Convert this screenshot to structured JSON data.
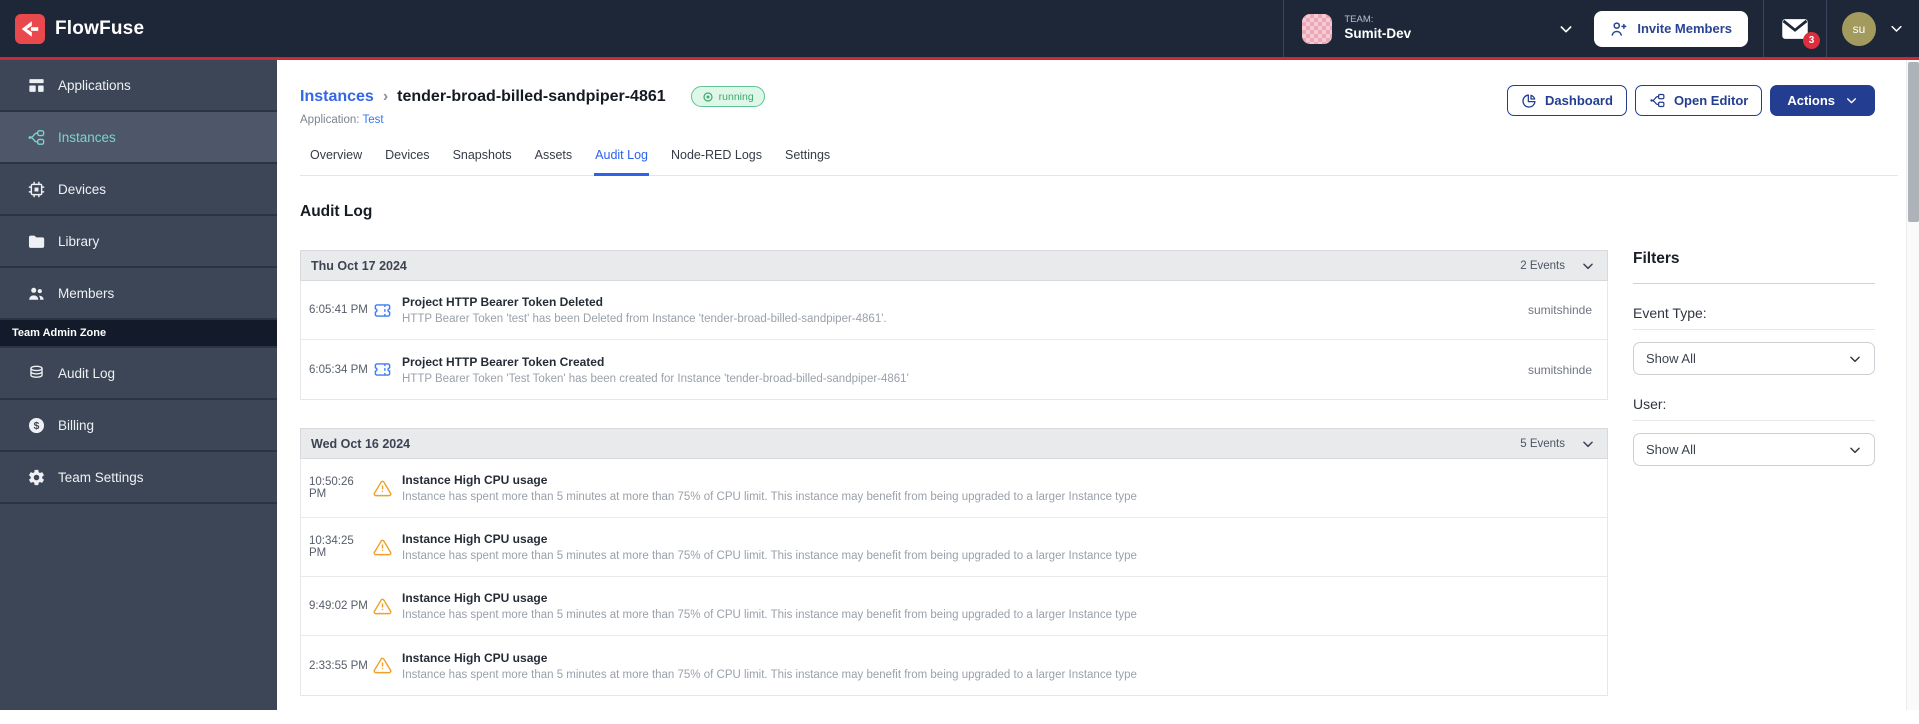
{
  "colors": {
    "topbar_bg": "#1d2738",
    "sidebar_bg": "#3d4656",
    "sidebar_active_bg": "#4e5769",
    "accent_teal": "#7cd6c8",
    "brand_red": "#e9494d",
    "red_line": "#c92a35",
    "navy_button": "#233d91",
    "link_blue": "#3566e8",
    "tab_active_blue": "#2c63e9",
    "running_green_text": "#41a86f",
    "running_green_bg": "#def7e9",
    "warning_orange": "#f0a02a",
    "token_blue": "#3d7ef2",
    "notification_red": "#dc2f3e"
  },
  "topbar": {
    "brand": "FlowFuse",
    "team_label": "TEAM:",
    "team_name": "Sumit-Dev",
    "invite_label": "Invite Members",
    "notification_count": "3",
    "avatar_initials": "su",
    "icons": [
      "flowfuse-logo",
      "team-avatar",
      "chevron-down-icon",
      "invite-members-icon",
      "mail-icon",
      "user-avatar"
    ]
  },
  "sidebar": {
    "items": [
      {
        "label": "Applications",
        "icon": "applications-icon",
        "active": false
      },
      {
        "label": "Instances",
        "icon": "instances-icon",
        "active": true
      },
      {
        "label": "Devices",
        "icon": "devices-icon",
        "active": false
      },
      {
        "label": "Library",
        "icon": "library-icon",
        "active": false
      },
      {
        "label": "Members",
        "icon": "members-icon",
        "active": false
      }
    ],
    "section_label": "Team Admin Zone",
    "admin_items": [
      {
        "label": "Audit Log",
        "icon": "audit-log-icon",
        "active": false
      },
      {
        "label": "Billing",
        "icon": "billing-icon",
        "active": false
      },
      {
        "label": "Team Settings",
        "icon": "team-settings-icon",
        "active": false
      }
    ]
  },
  "header": {
    "breadcrumb_parent": "Instances",
    "breadcrumb_separator": "›",
    "instance_name": "tender-broad-billed-sandpiper-4861",
    "status": "running",
    "application_label": "Application:",
    "application_name": "Test",
    "dashboard_label": "Dashboard",
    "open_editor_label": "Open Editor",
    "actions_label": "Actions"
  },
  "tabs": [
    {
      "label": "Overview",
      "active": false
    },
    {
      "label": "Devices",
      "active": false
    },
    {
      "label": "Snapshots",
      "active": false
    },
    {
      "label": "Assets",
      "active": false
    },
    {
      "label": "Audit Log",
      "active": true
    },
    {
      "label": "Node-RED Logs",
      "active": false
    },
    {
      "label": "Settings",
      "active": false
    }
  ],
  "audit": {
    "title": "Audit Log",
    "groups": [
      {
        "date": "Thu Oct 17 2024",
        "events_count": "2 Events",
        "rows": [
          {
            "time": "6:05:41 PM",
            "icon": "ticket-icon",
            "title": "Project HTTP Bearer Token Deleted",
            "description": "HTTP Bearer Token 'test' has been Deleted from Instance 'tender-broad-billed-sandpiper-4861'.",
            "user": "sumitshinde"
          },
          {
            "time": "6:05:34 PM",
            "icon": "ticket-icon",
            "title": "Project HTTP Bearer Token Created",
            "description": "HTTP Bearer Token 'Test Token' has been created for Instance 'tender-broad-billed-sandpiper-4861'",
            "user": "sumitshinde"
          }
        ]
      },
      {
        "date": "Wed Oct 16 2024",
        "events_count": "5 Events",
        "rows": [
          {
            "time": "10:50:26 PM",
            "icon": "warning-icon",
            "title": "Instance High CPU usage",
            "description": "Instance has spent more than 5 minutes at more than 75% of CPU limit. This instance may benefit from being upgraded to a larger Instance type",
            "user": ""
          },
          {
            "time": "10:34:25 PM",
            "icon": "warning-icon",
            "title": "Instance High CPU usage",
            "description": "Instance has spent more than 5 minutes at more than 75% of CPU limit. This instance may benefit from being upgraded to a larger Instance type",
            "user": ""
          },
          {
            "time": "9:49:02 PM",
            "icon": "warning-icon",
            "title": "Instance High CPU usage",
            "description": "Instance has spent more than 5 minutes at more than 75% of CPU limit. This instance may benefit from being upgraded to a larger Instance type",
            "user": ""
          },
          {
            "time": "2:33:55 PM",
            "icon": "warning-icon",
            "title": "Instance High CPU usage",
            "description": "Instance has spent more than 5 minutes at more than 75% of CPU limit. This instance may benefit from being upgraded to a larger Instance type",
            "user": ""
          }
        ]
      }
    ]
  },
  "filters": {
    "title": "Filters",
    "event_type_label": "Event Type:",
    "event_type_value": "Show All",
    "user_label": "User:",
    "user_value": "Show All"
  }
}
